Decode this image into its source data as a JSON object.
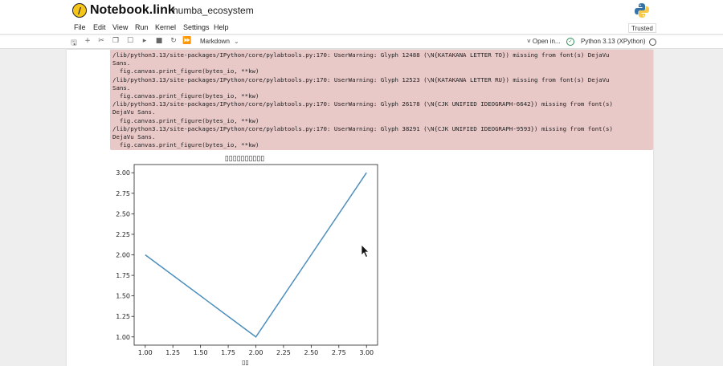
{
  "header": {
    "logo_text": "Notebook.link",
    "notebook_name": "numba_ecosystem"
  },
  "menu": {
    "items": [
      "File",
      "Edit",
      "View",
      "Run",
      "Kernel",
      "Settings",
      "Help"
    ],
    "trusted": "Trusted"
  },
  "toolbar": {
    "cell_type": "Markdown",
    "open_in": "˅ Open in...",
    "kernel": "Python 3.13 (XPython)"
  },
  "output": {
    "stderr_lines": [
      "/lib/python3.13/site-packages/IPython/core/pylabtools.py:170: UserWarning: Glyph 12488 (\\N{KATAKANA LETTER TO}) missing from font(s) DejaVu",
      "Sans.",
      "  fig.canvas.print_figure(bytes_io, **kw)",
      "/lib/python3.13/site-packages/IPython/core/pylabtools.py:170: UserWarning: Glyph 12523 (\\N{KATAKANA LETTER RU}) missing from font(s) DejaVu",
      "Sans.",
      "  fig.canvas.print_figure(bytes_io, **kw)",
      "/lib/python3.13/site-packages/IPython/core/pylabtools.py:170: UserWarning: Glyph 26178 (\\N{CJK UNIFIED IDEOGRAPH-6642}) missing from font(s)",
      "DejaVu Sans.",
      "  fig.canvas.print_figure(bytes_io, **kw)",
      "/lib/python3.13/site-packages/IPython/core/pylabtools.py:170: UserWarning: Glyph 38291 (\\N{CJK UNIFIED IDEOGRAPH-9593}) missing from font(s)",
      "DejaVu Sans.",
      "  fig.canvas.print_figure(bytes_io, **kw)"
    ]
  },
  "chart_data": {
    "type": "line",
    "title": "▯▯▯▯▯▯▯▯▯▯",
    "xlabel": "▯▯",
    "ylabel": "",
    "x": [
      1.0,
      2.0,
      3.0
    ],
    "series": [
      {
        "values": [
          2.0,
          1.0,
          3.0
        ],
        "color": "#4c8fbd"
      }
    ],
    "xlim": [
      0.9,
      3.1
    ],
    "ylim": [
      0.9,
      3.1
    ],
    "xticks": [
      "1.00",
      "1.25",
      "1.50",
      "1.75",
      "2.00",
      "2.25",
      "2.50",
      "2.75",
      "3.00"
    ],
    "yticks": [
      "1.00",
      "1.25",
      "1.50",
      "1.75",
      "2.00",
      "2.25",
      "2.50",
      "2.75",
      "3.00"
    ],
    "grid": false
  }
}
